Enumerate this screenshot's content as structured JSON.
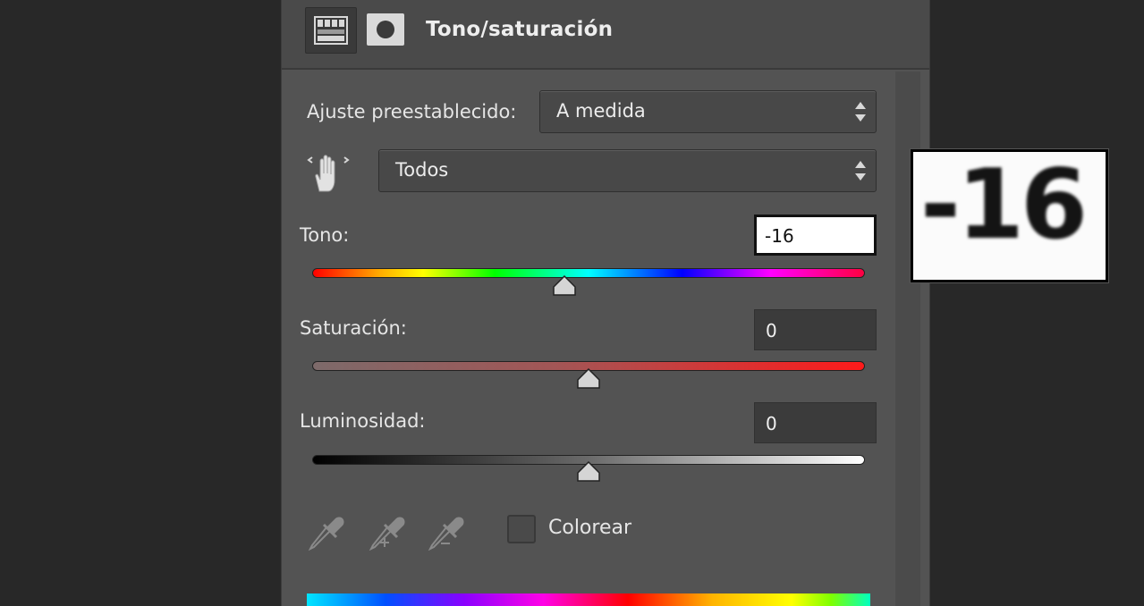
{
  "panel": {
    "title": "Tono/saturación",
    "icons": [
      "adjustment-layer-icon",
      "layer-mask-icon"
    ]
  },
  "preset": {
    "label": "Ajuste preestablecido:",
    "value": "A medida"
  },
  "channel": {
    "icon": "targeted-adjustment-hand-icon",
    "value": "Todos"
  },
  "hue": {
    "label": "Tono:",
    "value": "-16",
    "slider_level": -16,
    "slider_range": [
      -180,
      180
    ]
  },
  "saturation": {
    "label": "Saturación:",
    "value": "0",
    "slider_level": 0,
    "slider_range": [
      -100,
      100
    ]
  },
  "lightness": {
    "label": "Luminosidad:",
    "value": "0",
    "slider_level": 0,
    "slider_range": [
      -100,
      100
    ]
  },
  "tools": [
    "eyedropper-icon",
    "eyedropper-add-icon",
    "eyedropper-subtract-icon"
  ],
  "colorize": {
    "label": "Colorear",
    "checked": false
  },
  "zoom_callout": {
    "value": "-16"
  }
}
